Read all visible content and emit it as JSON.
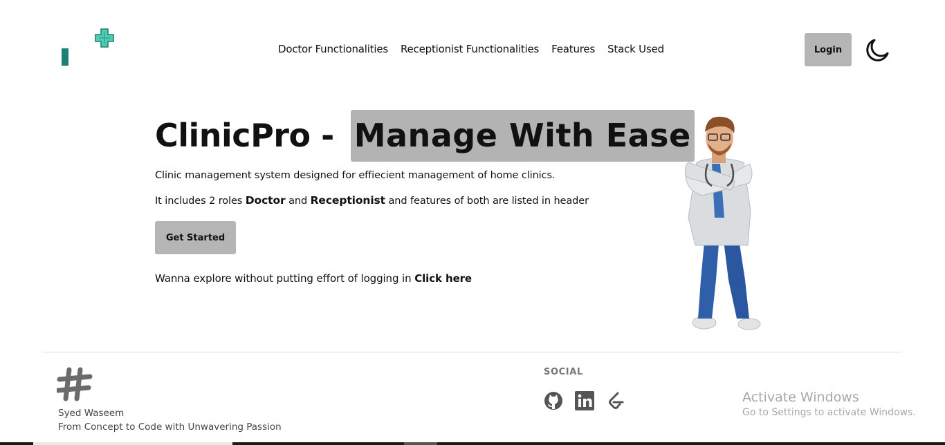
{
  "header": {
    "nav": [
      {
        "label": "Doctor Functionalities"
      },
      {
        "label": "Receptionist Functionalities"
      },
      {
        "label": "Features"
      },
      {
        "label": "Stack Used"
      }
    ],
    "login_label": "Login",
    "theme_icon": "moon-icon",
    "logo_icon": "medical-cross-icon"
  },
  "hero": {
    "title_plain": "ClinicPro -",
    "title_highlight": "Manage With Ease",
    "description": "Clinic management system designed for effiecient management of home clinics.",
    "roles_prefix": "It includes 2 roles",
    "role_doctor": "Doctor",
    "roles_and": "and",
    "role_receptionist": "Receptionist",
    "roles_suffix": "and features of both are listed in header",
    "cta_label": "Get Started",
    "explore_text": "Wanna explore without putting effort of logging in",
    "explore_link": "Click here",
    "illustration": "doctor-illustration"
  },
  "footer": {
    "logo_icon": "hashtag-icon",
    "author": "Syed Waseem",
    "tagline": "From Concept to Code with Unwavering Passion",
    "social_title": "SOCIAL",
    "social_icons": [
      "github-icon",
      "linkedin-icon",
      "leetcode-icon"
    ]
  },
  "watermark": {
    "title": "Activate Windows",
    "subtitle": "Go to Settings to activate Windows."
  },
  "colors": {
    "brand_teal": "#1f7f78",
    "cross_green": "#4ecdb0",
    "button_gray": "#b5b5b5",
    "highlight_gray": "#b3b3b3"
  }
}
